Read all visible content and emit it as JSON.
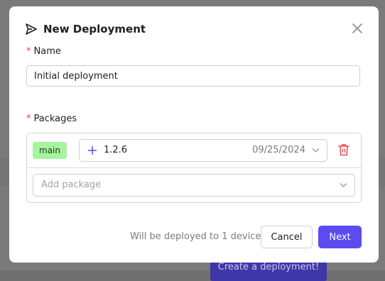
{
  "background": {
    "create_button_label": "Create a deployment!"
  },
  "modal": {
    "title": "New Deployment",
    "title_icon": "send-icon",
    "close_icon": "close-icon"
  },
  "form": {
    "name": {
      "required_marker": "*",
      "label": "Name",
      "value": "Initial deployment"
    },
    "packages": {
      "required_marker": "*",
      "label": "Packages",
      "items": [
        {
          "branch": "main",
          "version": "1.2.6",
          "date": "09/25/2024",
          "add_icon": "plus-icon",
          "dropdown_icon": "chevron-down-icon",
          "delete_icon": "trash-icon"
        }
      ],
      "add_placeholder": "Add package"
    }
  },
  "footer": {
    "note": "Will be deployed to 1 device",
    "cancel_label": "Cancel",
    "next_label": "Next"
  },
  "colors": {
    "accent": "#5b4bf0",
    "required": "#e5484d",
    "branch_badge_bg": "#a7f3a0",
    "delete": "#e5484d"
  }
}
